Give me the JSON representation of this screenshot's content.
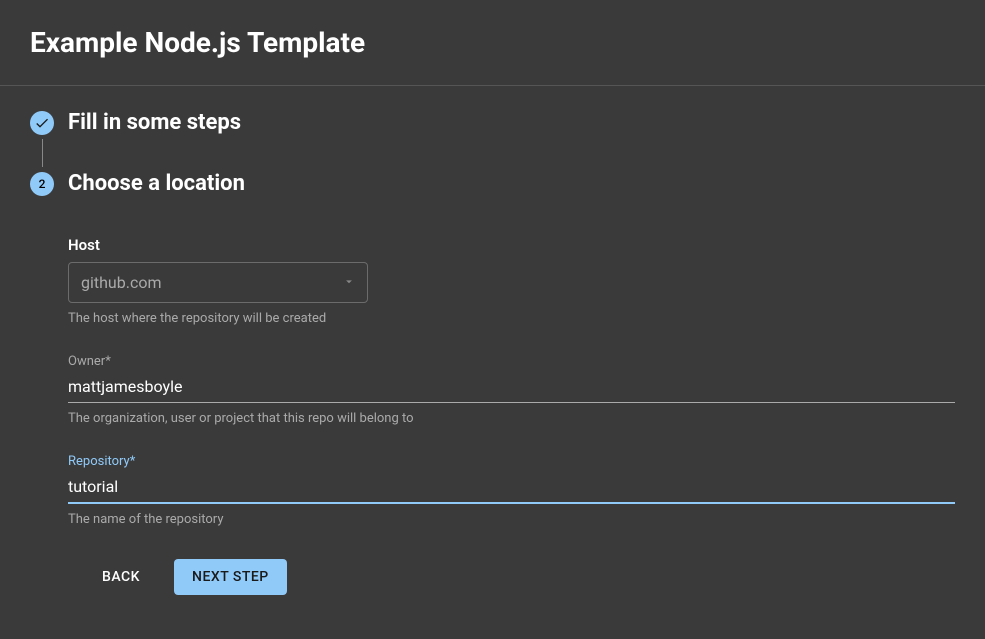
{
  "header": {
    "title": "Example Node.js Template"
  },
  "steps": {
    "step1": {
      "title": "Fill in some steps",
      "completed": true
    },
    "step2": {
      "number": "2",
      "title": "Choose a location"
    }
  },
  "form": {
    "host": {
      "label": "Host",
      "value": "github.com",
      "helper": "The host where the repository will be created"
    },
    "owner": {
      "label": "Owner*",
      "value": "mattjamesboyle",
      "helper": "The organization, user or project that this repo will belong to"
    },
    "repository": {
      "label": "Repository*",
      "value": "tutorial",
      "helper": "The name of the repository"
    }
  },
  "buttons": {
    "back": "BACK",
    "next": "NEXT STEP"
  }
}
